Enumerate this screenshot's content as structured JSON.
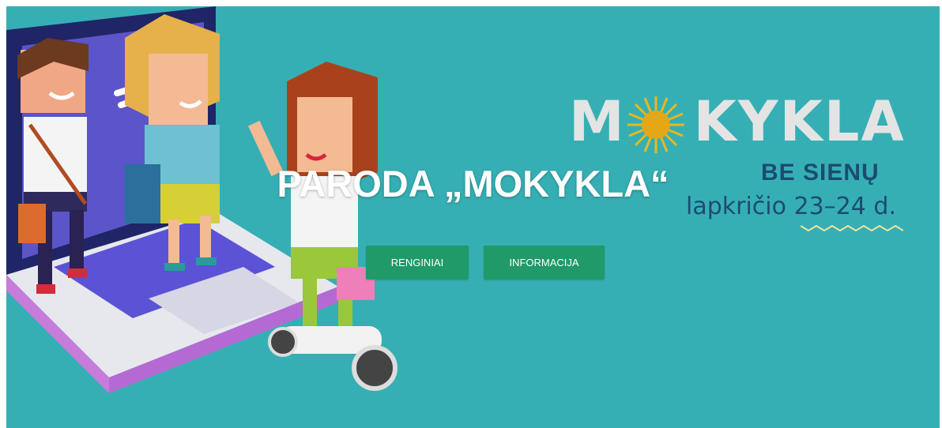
{
  "hero": {
    "background": "#36afb4",
    "title": "PARODA „MOKYKLA“",
    "buttons": [
      {
        "label": "RENGINIAI"
      },
      {
        "label": "INFORMACIJA"
      }
    ],
    "accent": "#1f9a68"
  },
  "logo": {
    "word_first": "M",
    "word_rest": "KYKLA",
    "subtitle": "BE SIENŲ",
    "date": "lapkričio 23–24 d.",
    "sun_color": "#e8b81d",
    "text_color": "#1c4b72"
  },
  "illustration": {
    "subject": "isometric cartoon kids stepping out of a laptop screen, one riding a hoverboard"
  }
}
